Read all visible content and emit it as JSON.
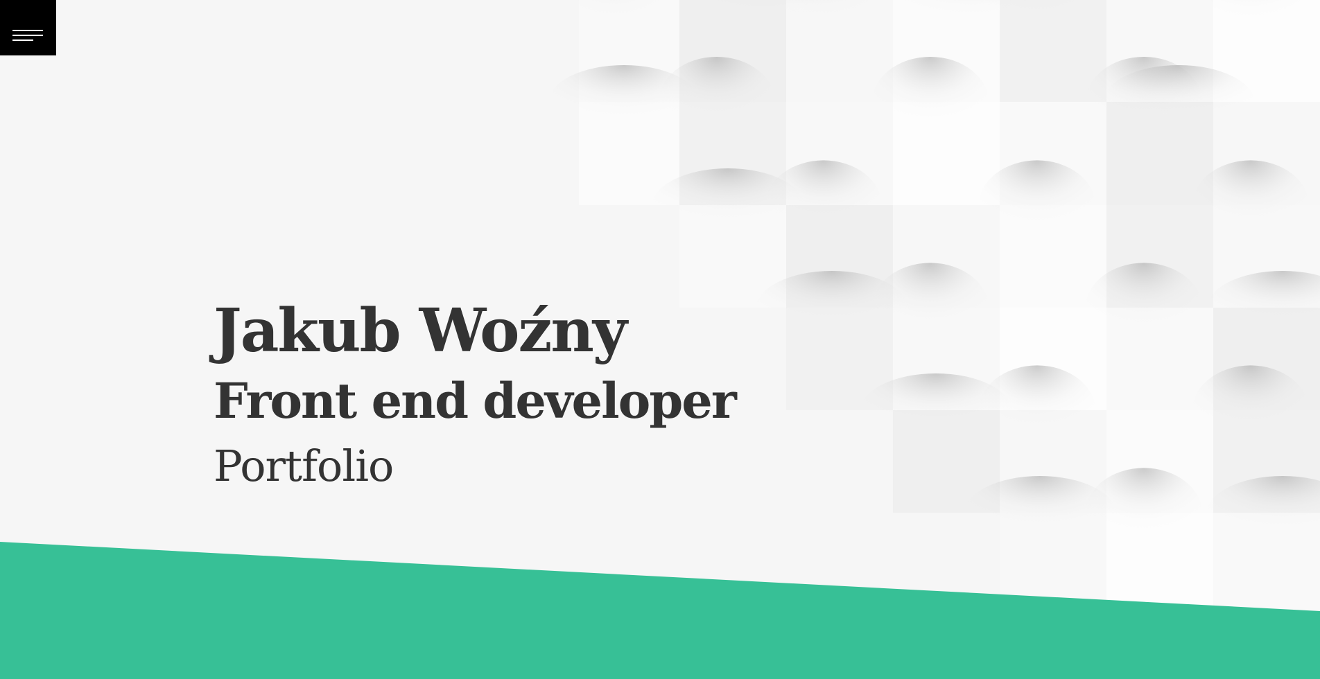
{
  "menu": {
    "icon": "hamburger-icon"
  },
  "hero": {
    "name": "Jakub Woźny",
    "role": "Front end developer",
    "subtitle": "Portfolio"
  },
  "colors": {
    "background": "#f6f6f6",
    "accent": "#37c096",
    "text": "#333333",
    "menu_bg": "#000000"
  }
}
